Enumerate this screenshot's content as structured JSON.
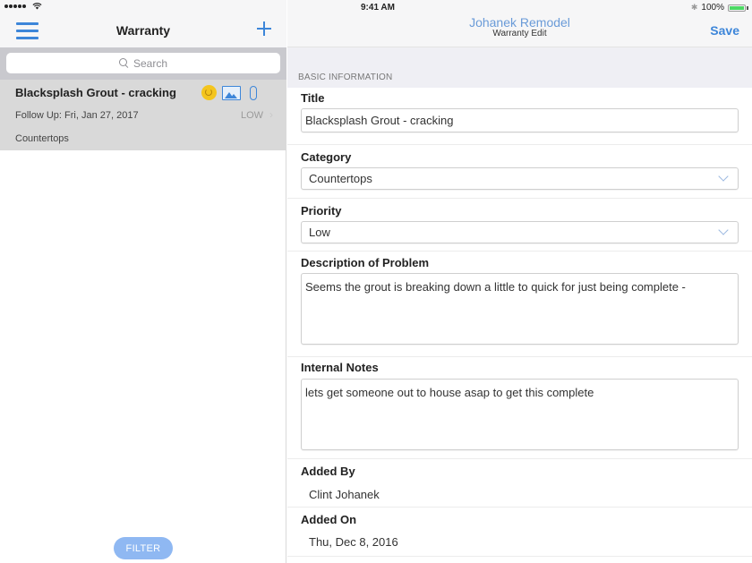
{
  "status_bar": {
    "time": "9:41 AM",
    "battery_percent": "100%",
    "battery_level": 1.0,
    "icons": [
      "signal-dots",
      "wifi-icon",
      "bluetooth-icon",
      "battery-icon"
    ]
  },
  "sidebar": {
    "title": "Warranty",
    "menu_icon": "hamburger-icon",
    "add_icon": "plus-icon",
    "search": {
      "placeholder": "Search",
      "value": ""
    },
    "items": [
      {
        "title": "Blacksplash Grout - cracking",
        "follow_up": "Follow Up: Fri, Jan 27, 2017",
        "priority": "LOW",
        "category": "Countertops",
        "icons": [
          "sync-icon",
          "image-icon",
          "paperclip-icon"
        ],
        "selected": true
      }
    ],
    "filter_label": "FILTER"
  },
  "detail": {
    "nav": {
      "title": "Johanek Remodel",
      "subtitle": "Warranty Edit",
      "save_label": "Save"
    },
    "section_header": "BASIC INFORMATION",
    "fields": {
      "title": {
        "label": "Title",
        "value": "Blacksplash Grout - cracking"
      },
      "category": {
        "label": "Category",
        "value": "Countertops"
      },
      "priority": {
        "label": "Priority",
        "value": "Low"
      },
      "description": {
        "label": "Description of Problem",
        "value": "Seems the grout is breaking down a little to quick for just being complete -"
      },
      "internal_notes": {
        "label": "Internal Notes",
        "value": "lets get someone out to house asap to get this complete"
      },
      "added_by": {
        "label": "Added By",
        "value": "Clint Johanek"
      },
      "added_on": {
        "label": "Added On",
        "value": "Thu, Dec 8, 2016"
      }
    }
  },
  "colors": {
    "accent": "#3d86d9",
    "nav_title": "#6a9bd8",
    "filter_button": "#8fb8f2",
    "selected_row": "#d9d9d9",
    "sync_badge": "#f4c51e",
    "battery": "#4cd964"
  }
}
